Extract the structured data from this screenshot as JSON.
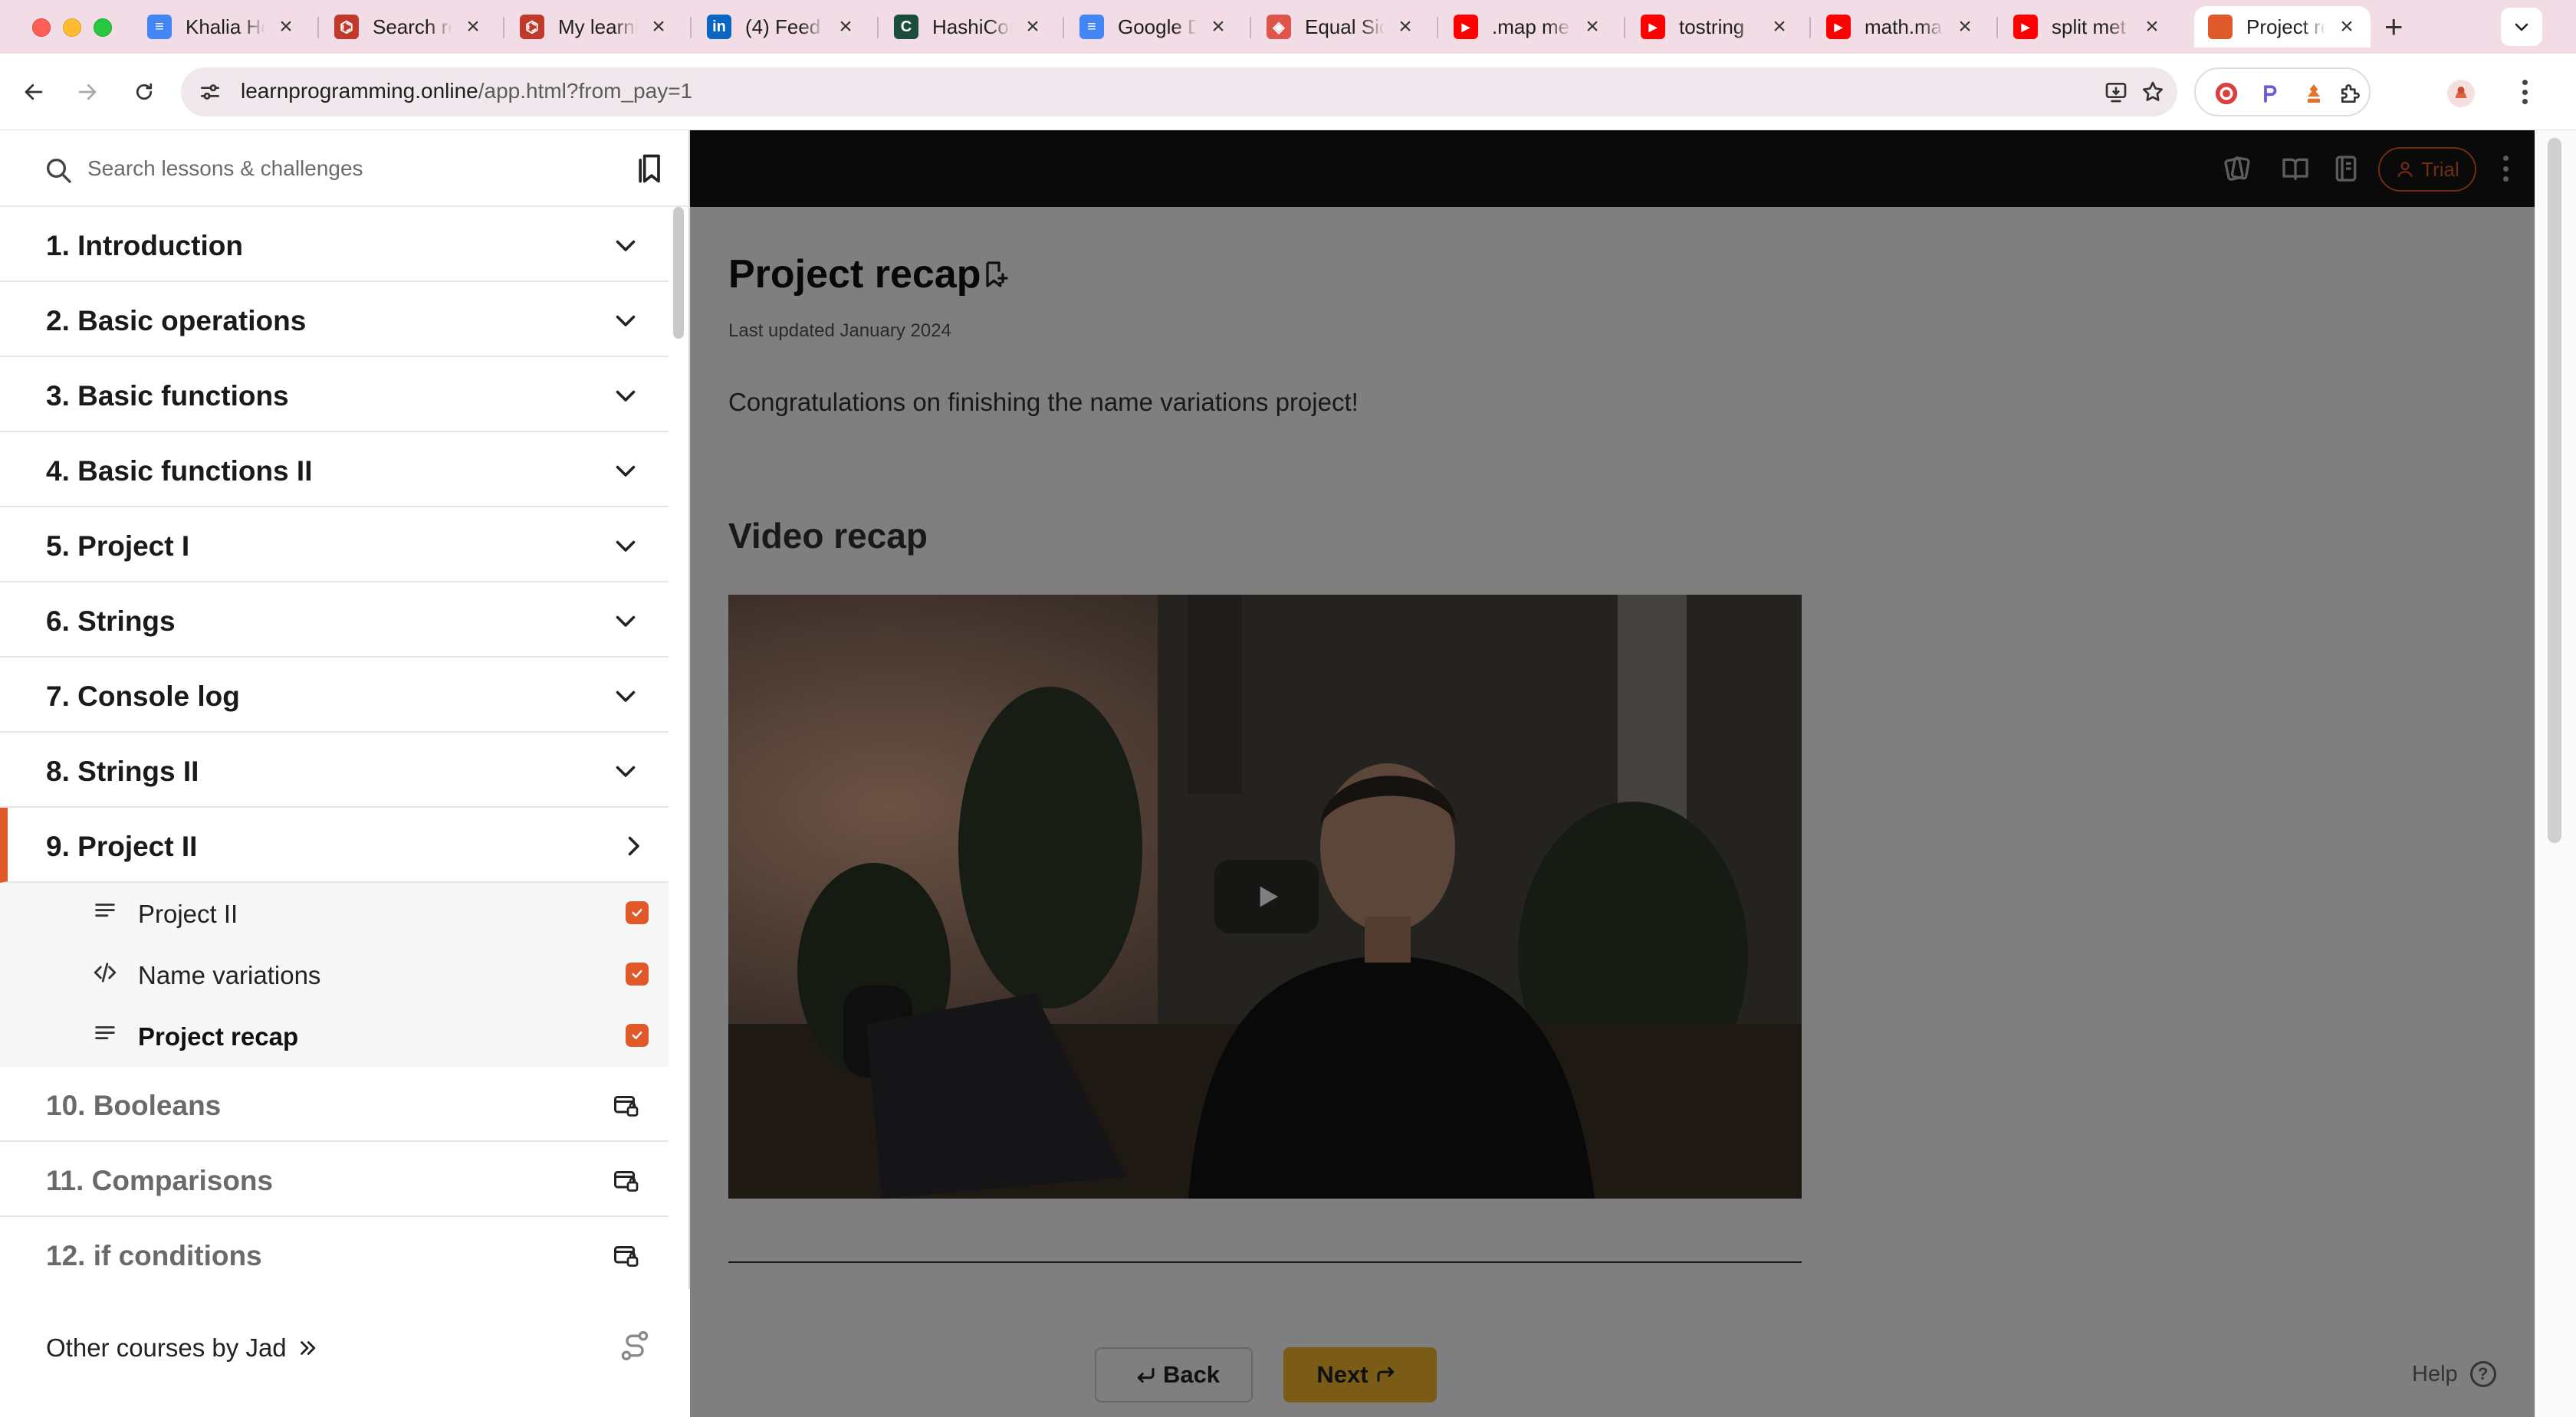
{
  "browser": {
    "tabs": [
      {
        "title": "Khalia Ho",
        "icon": "google-docs-icon",
        "color": "#4285f4"
      },
      {
        "title": "Search re",
        "icon": "learnprogramming-icon",
        "color": "#c0392b"
      },
      {
        "title": "My learni",
        "icon": "learnprogramming-icon",
        "color": "#c0392b"
      },
      {
        "title": "(4) Feed",
        "icon": "linkedin-icon",
        "color": "#0a66c2"
      },
      {
        "title": "HashiCor",
        "icon": "hashicorp-icon",
        "color": "#1b4d3e"
      },
      {
        "title": "Google D",
        "icon": "google-docs-icon",
        "color": "#4285f4"
      },
      {
        "title": "Equal Sid",
        "icon": "equal-sides-icon",
        "color": "#e0554a"
      },
      {
        "title": ".map me",
        "icon": "youtube-icon",
        "color": "#ff0000"
      },
      {
        "title": "tostring",
        "icon": "youtube-icon",
        "color": "#ff0000"
      },
      {
        "title": "math.ma",
        "icon": "youtube-icon",
        "color": "#ff0000"
      },
      {
        "title": "split met",
        "icon": "youtube-icon",
        "color": "#ff0000"
      },
      {
        "title": "Project re",
        "icon": "code-tag-icon",
        "color": "#e05a29",
        "active": true
      }
    ],
    "url_host": "learnprogramming.online",
    "url_path": "/app.html?from_pay=1"
  },
  "sidebar": {
    "search_placeholder": "Search lessons & challenges",
    "chapters": [
      {
        "label": "1. Introduction",
        "state": "collapsed"
      },
      {
        "label": "2. Basic operations",
        "state": "collapsed"
      },
      {
        "label": "3. Basic functions",
        "state": "collapsed"
      },
      {
        "label": "4. Basic functions II",
        "state": "collapsed"
      },
      {
        "label": "5. Project I",
        "state": "collapsed"
      },
      {
        "label": "6. Strings",
        "state": "collapsed"
      },
      {
        "label": "7. Console log",
        "state": "collapsed"
      },
      {
        "label": "8. Strings II",
        "state": "collapsed"
      },
      {
        "label": "9. Project II",
        "state": "active"
      }
    ],
    "lessons": [
      {
        "label": "Project II",
        "type": "text",
        "completed": true
      },
      {
        "label": "Name variations",
        "type": "code",
        "completed": true
      },
      {
        "label": "Project recap",
        "type": "text",
        "completed": true,
        "current": true
      }
    ],
    "locked_chapters": [
      {
        "label": "10. Booleans"
      },
      {
        "label": "11. Comparisons"
      },
      {
        "label": "12. if conditions"
      }
    ],
    "footer_link": "Other courses by Jad"
  },
  "main": {
    "trial_label": "Trial",
    "title": "Project recap",
    "updated": "Last updated January 2024",
    "intro": "Congratulations on finishing the name variations project!",
    "section_title": "Video recap",
    "back_label": "Back",
    "next_label": "Next",
    "help_label": "Help"
  },
  "colors": {
    "accent": "#e05a29",
    "next_button": "#f5b82e",
    "topbar": "#141414"
  }
}
